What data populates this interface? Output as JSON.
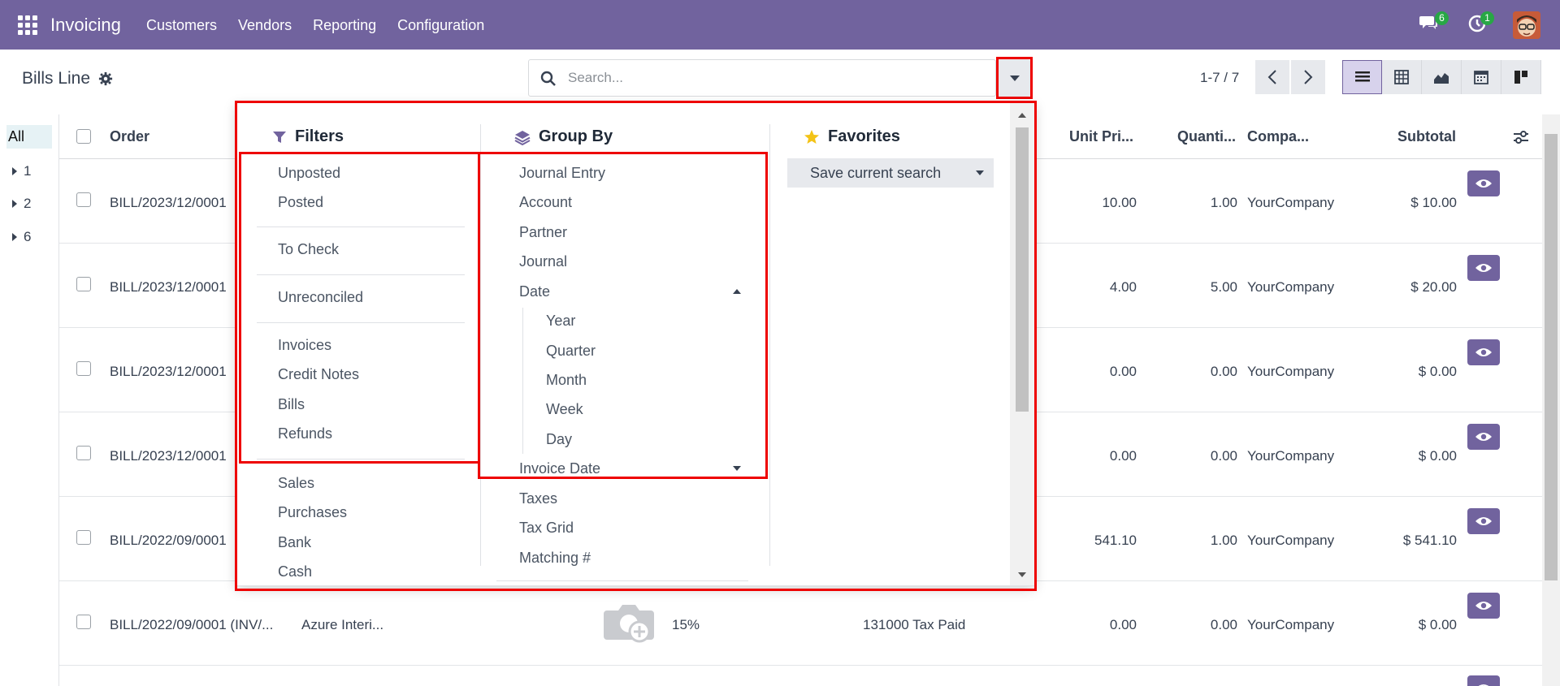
{
  "navbar": {
    "brand": "Invoicing",
    "menu": [
      "Customers",
      "Vendors",
      "Reporting",
      "Configuration"
    ],
    "chat_badge": "6",
    "activity_badge": "1"
  },
  "control": {
    "breadcrumb": "Bills Line",
    "search_placeholder": "Search...",
    "pager": "1-7 / 7"
  },
  "side_panel": {
    "all_label": "All",
    "items": [
      "1",
      "2",
      "6"
    ]
  },
  "list": {
    "headers": {
      "order": "Order",
      "unit_price": "Unit Pri...",
      "quantity": "Quanti...",
      "company": "Compa...",
      "subtotal": "Subtotal"
    },
    "rows": [
      {
        "order": "BILL/2023/12/0001",
        "unit_price": "10.00",
        "quantity": "1.00",
        "company": "YourCompany",
        "subtotal": "$ 10.00"
      },
      {
        "order": "BILL/2023/12/0001",
        "unit_price": "4.00",
        "quantity": "5.00",
        "company": "YourCompany",
        "subtotal": "$ 20.00"
      },
      {
        "order": "BILL/2023/12/0001",
        "unit_price": "0.00",
        "quantity": "0.00",
        "company": "YourCompany",
        "subtotal": "$ 0.00"
      },
      {
        "order": "BILL/2023/12/0001",
        "unit_price": "0.00",
        "quantity": "0.00",
        "company": "YourCompany",
        "subtotal": "$ 0.00"
      },
      {
        "order": "BILL/2022/09/0001",
        "unit_price": "541.10",
        "quantity": "1.00",
        "company": "YourCompany",
        "subtotal": "$ 541.10"
      },
      {
        "order": "BILL/2022/09/0001 (INV/...",
        "partner": "Azure Interi...",
        "tax": "15%",
        "account": "131000 Tax Paid",
        "unit_price": "0.00",
        "quantity": "0.00",
        "company": "YourCompany",
        "subtotal": "$ 0.00"
      }
    ]
  },
  "dropdown": {
    "filters": {
      "title": "Filters",
      "group1": [
        "Unposted",
        "Posted"
      ],
      "group2": [
        "To Check"
      ],
      "group3": [
        "Unreconciled"
      ],
      "group4": [
        "Invoices",
        "Credit Notes",
        "Bills",
        "Refunds"
      ],
      "group5": [
        "Sales",
        "Purchases",
        "Bank",
        "Cash"
      ]
    },
    "group_by": {
      "title": "Group By",
      "items": [
        "Journal Entry",
        "Account",
        "Partner",
        "Journal",
        "Date"
      ],
      "date_options": [
        "Year",
        "Quarter",
        "Month",
        "Week",
        "Day"
      ],
      "more": [
        "Invoice Date",
        "Taxes",
        "Tax Grid",
        "Matching #"
      ]
    },
    "favorites": {
      "title": "Favorites",
      "save_label": "Save current search"
    }
  },
  "colors": {
    "brand": "#71639e",
    "highlight": "#ee0000",
    "badge": "#28a745"
  }
}
